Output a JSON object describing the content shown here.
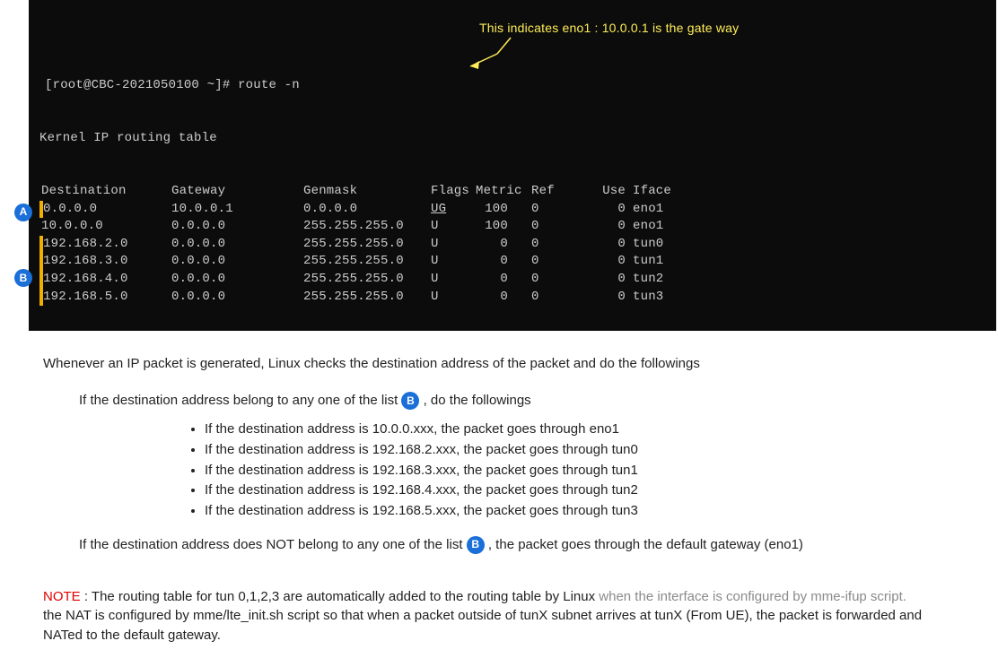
{
  "terminal": {
    "prompt": "[root@CBC-2021050100 ~]# route -n",
    "header0": "Kernel IP routing table",
    "cols": {
      "dest": "Destination",
      "gateway": "Gateway",
      "genmask": "Genmask",
      "flags": "Flags",
      "metric": "Metric",
      "ref": "Ref",
      "use": "Use",
      "iface": "Iface"
    },
    "rows": [
      {
        "dest": "0.0.0.0",
        "gateway": "10.0.0.1",
        "genmask": "0.0.0.0",
        "flags": "UG",
        "metric": "100",
        "ref": "0",
        "use": "0",
        "iface": "eno1"
      },
      {
        "dest": "10.0.0.0",
        "gateway": "0.0.0.0",
        "genmask": "255.255.255.0",
        "flags": "U",
        "metric": "100",
        "ref": "0",
        "use": "0",
        "iface": "eno1"
      },
      {
        "dest": "192.168.2.0",
        "gateway": "0.0.0.0",
        "genmask": "255.255.255.0",
        "flags": "U",
        "metric": "0",
        "ref": "0",
        "use": "0",
        "iface": "tun0"
      },
      {
        "dest": "192.168.3.0",
        "gateway": "0.0.0.0",
        "genmask": "255.255.255.0",
        "flags": "U",
        "metric": "0",
        "ref": "0",
        "use": "0",
        "iface": "tun1"
      },
      {
        "dest": "192.168.4.0",
        "gateway": "0.0.0.0",
        "genmask": "255.255.255.0",
        "flags": "U",
        "metric": "0",
        "ref": "0",
        "use": "0",
        "iface": "tun2"
      },
      {
        "dest": "192.168.5.0",
        "gateway": "0.0.0.0",
        "genmask": "255.255.255.0",
        "flags": "U",
        "metric": "0",
        "ref": "0",
        "use": "0",
        "iface": "tun3"
      }
    ],
    "annotation": "This indicates eno1 : 10.0.0.1 is the gate way"
  },
  "badges": {
    "A": "A",
    "B": "B"
  },
  "body": {
    "p1": "Whenever an IP packet is generated, Linux checks the destination address of the packet and do the followings",
    "p2a": "If the destination address belong to any one of the list ",
    "p2b": " , do the followings",
    "bullets": [
      "If the destination address is 10.0.0.xxx, the packet goes through eno1",
      "If the destination address is 192.168.2.xxx, the packet goes through tun0",
      "If the destination address is 192.168.3.xxx, the packet goes through tun1",
      "If the destination address is 192.168.4.xxx, the packet goes through tun2",
      "If the destination address is 192.168.5.xxx, the packet goes through tun3"
    ],
    "p3a": "If the destination address does NOT belong to any one of the list ",
    "p3b": " , the packet goes through the default gateway (eno1)",
    "noteLabel": "NOTE",
    "noteColon": " : ",
    "note1a": "The routing table for tun 0,1,2,3 are automatically added to the routing table by Linux ",
    "note1b": "when the interface is configured by mme-ifup script.",
    "note2": "the NAT is configured by mme/lte_init.sh script so that when a packet outside of tunX subnet arrives at tunX (From UE), the packet is forwarded and NATed to the default gateway."
  }
}
